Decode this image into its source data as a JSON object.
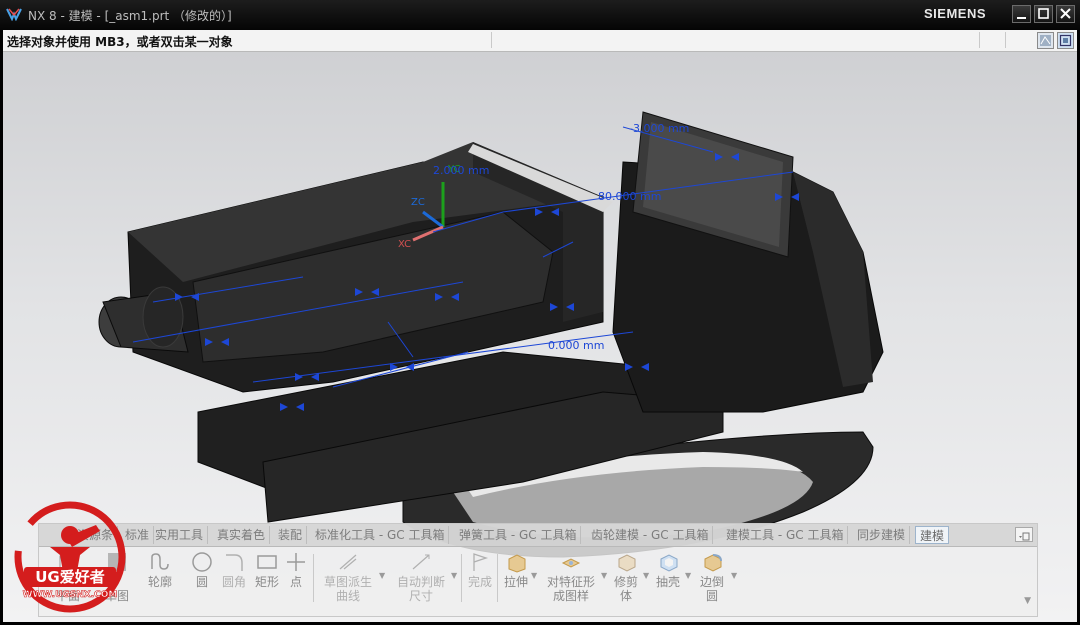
{
  "window": {
    "title": "NX 8 - 建模 - [_asm1.prt （修改的）]",
    "brand": "SIEMENS"
  },
  "cue_line": {
    "text": "选择对象并使用 MB3，或者双击某一对象"
  },
  "annotations": {
    "dim_top": "-3.000 mm",
    "dim_mid": "80.000 mm",
    "dim_left": "2.000 mm",
    "dim_bottom": "0.000 mm",
    "axis_z": "ZC",
    "axis_y": "YC",
    "axis_x": "XC"
  },
  "ribbon": {
    "tabs": [
      "资源条",
      "标准",
      "实用工具",
      "真实着色",
      "装配",
      "标准化工具 - GC 工具箱",
      "弹簧工具 - GC 工具箱",
      "齿轮建模 - GC 工具箱",
      "建模工具 - GC 工具箱",
      "同步建模",
      "建模"
    ],
    "active_tab": "建模",
    "tools": {
      "sketch_plane": "平面",
      "sketch_util": "草图",
      "profile": "轮廓",
      "circle": "圆",
      "fillet": "圆角",
      "rectangle": "矩形",
      "point": "点",
      "derived_curve": "草图派生",
      "derived_curve_2": "曲线",
      "auto_dim": "自动判断",
      "auto_dim_2": "尺寸",
      "finish": "完成",
      "extrude": "拉伸",
      "feature_array": "对特征形",
      "feature_array_2": "成图样",
      "trim_body": "修剪",
      "trim_body_2": "体",
      "shell": "抽壳",
      "edge_blend": "边倒",
      "edge_blend_2": "圆"
    }
  },
  "watermark": {
    "logo_text": "UG爱好者",
    "url": "WWW.UGSNX.COM"
  },
  "colors": {
    "dimension_blue": "#1d47d6",
    "model_dark": "#1c1c1c",
    "ui_background": "#f3f3f3"
  }
}
